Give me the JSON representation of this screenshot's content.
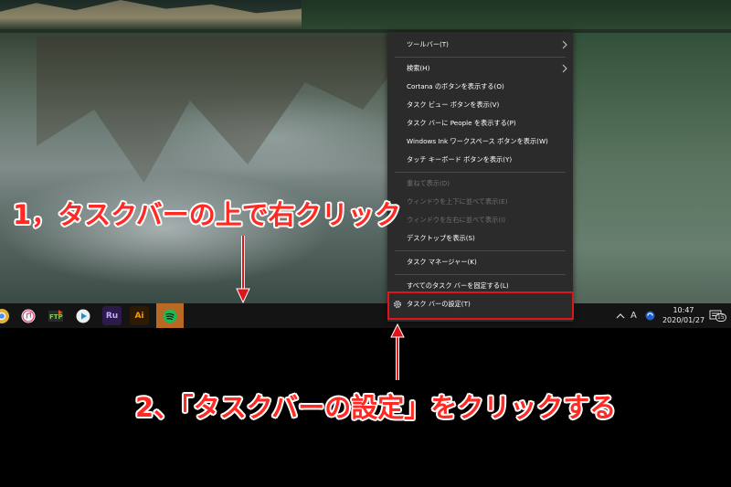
{
  "menu": {
    "items": [
      {
        "label": "ツールバー(T)",
        "submenu": true,
        "disabled": false
      },
      {
        "label": "検索(H)",
        "submenu": true,
        "disabled": false
      },
      {
        "label": "Cortana のボタンを表示する(O)",
        "submenu": false,
        "disabled": false
      },
      {
        "label": "タスク ビュー ボタンを表示(V)",
        "submenu": false,
        "disabled": false
      },
      {
        "label": "タスク バーに People を表示する(P)",
        "submenu": false,
        "disabled": false
      },
      {
        "label": "Windows Ink ワークスペース ボタンを表示(W)",
        "submenu": false,
        "disabled": false
      },
      {
        "label": "タッチ キーボード ボタンを表示(Y)",
        "submenu": false,
        "disabled": false
      },
      {
        "label": "重ねて表示(D)",
        "submenu": false,
        "disabled": true
      },
      {
        "label": "ウィンドウを上下に並べて表示(E)",
        "submenu": false,
        "disabled": true
      },
      {
        "label": "ウィンドウを左右に並べて表示(I)",
        "submenu": false,
        "disabled": true
      },
      {
        "label": "デスクトップを表示(S)",
        "submenu": false,
        "disabled": false
      },
      {
        "label": "タスク マネージャー(K)",
        "submenu": false,
        "disabled": false
      },
      {
        "label": "すべてのタスク バーを固定する(L)",
        "submenu": false,
        "disabled": false
      },
      {
        "label": "タスク バーの設定(T)",
        "submenu": false,
        "disabled": false,
        "icon": "gear-icon"
      }
    ]
  },
  "taskbar": {
    "pinned_apps": [
      {
        "name": "chrome-icon"
      },
      {
        "name": "itunes-icon"
      },
      {
        "name": "ftp-client-icon"
      },
      {
        "name": "media-player-icon"
      },
      {
        "name": "adobe-rush-icon",
        "text": "Ru",
        "color": "#9b7cf5"
      },
      {
        "name": "adobe-illustrator-icon",
        "text": "Ai",
        "color": "#ff9a00"
      },
      {
        "name": "spotify-icon",
        "active": true
      }
    ],
    "tray": {
      "ime_label": "A",
      "time": "10:47",
      "date": "2020/01/27",
      "notification_count": "15"
    }
  },
  "annotations": {
    "step1": "1，タスクバーの上で右クリック",
    "step2": "2、「タスクバーの設定」をクリックする",
    "color": "#ff2a24"
  }
}
